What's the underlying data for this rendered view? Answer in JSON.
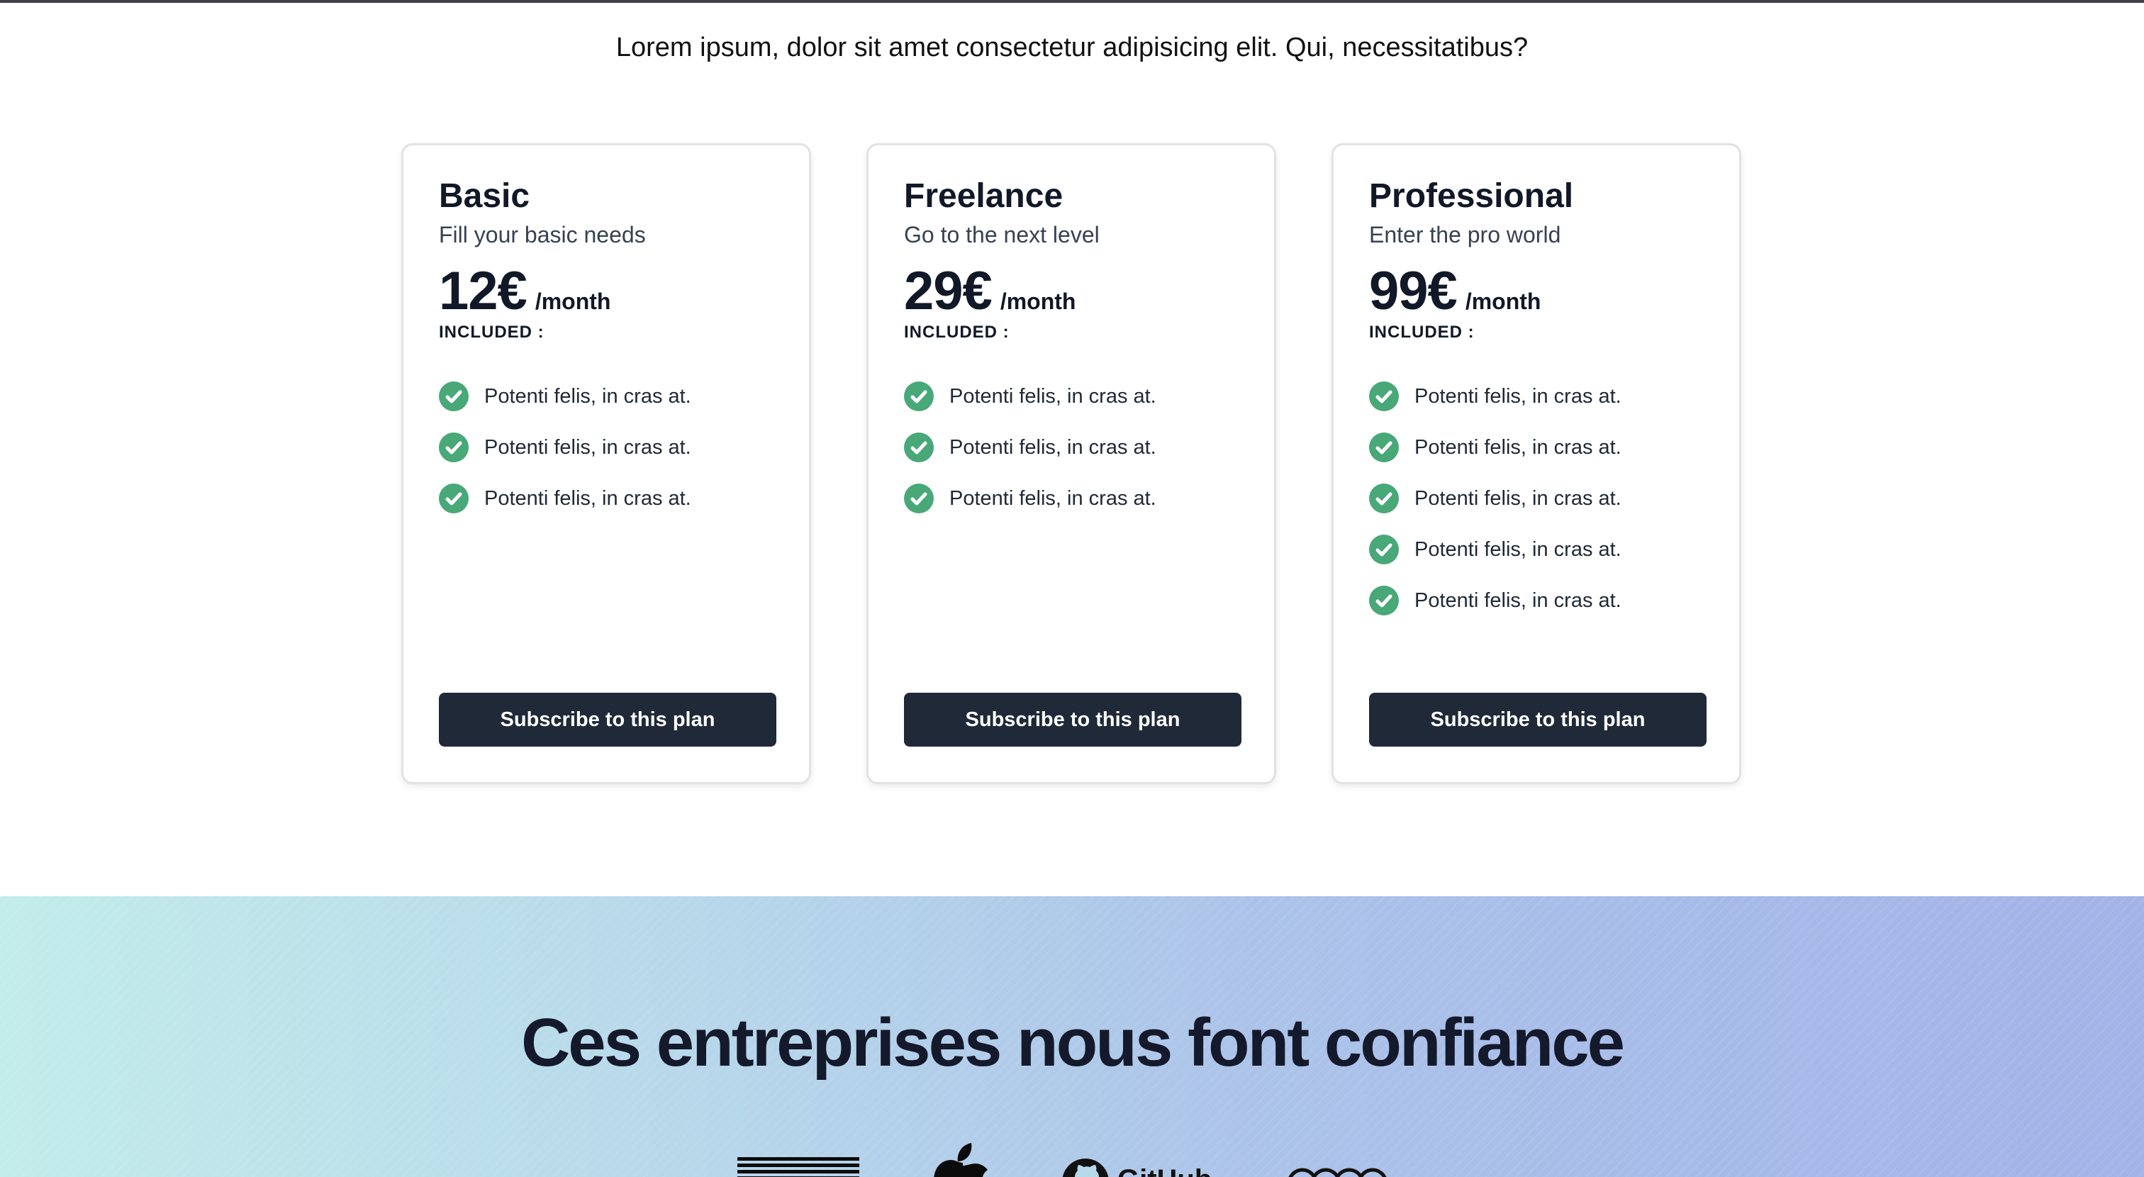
{
  "intro_text": "Lorem ipsum, dolor sit amet consectetur adipisicing elit. Qui, necessitatibus?",
  "plans": [
    {
      "name": "Basic",
      "subtitle": "Fill your basic needs",
      "price": "12€",
      "period": "/month",
      "included_label": "INCLUDED :",
      "features": [
        "Potenti felis, in cras at.",
        "Potenti felis, in cras at.",
        "Potenti felis, in cras at."
      ],
      "button_label": "Subscribe to this plan"
    },
    {
      "name": "Freelance",
      "subtitle": "Go to the next level",
      "price": "29€",
      "period": "/month",
      "included_label": "INCLUDED :",
      "features": [
        "Potenti felis, in cras at.",
        "Potenti felis, in cras at.",
        "Potenti felis, in cras at."
      ],
      "button_label": "Subscribe to this plan"
    },
    {
      "name": "Professional",
      "subtitle": "Enter the pro world",
      "price": "99€",
      "period": "/month",
      "included_label": "INCLUDED :",
      "features": [
        "Potenti felis, in cras at.",
        "Potenti felis, in cras at.",
        "Potenti felis, in cras at.",
        "Potenti felis, in cras at.",
        "Potenti felis, in cras at."
      ],
      "button_label": "Subscribe to this plan"
    }
  ],
  "trust": {
    "title": "Ces entreprises nous font confiance",
    "logos": [
      "ibm-logo",
      "apple-logo",
      "github-logo",
      "audi-logo"
    ],
    "github_label": "GitHub"
  },
  "colors": {
    "check_green": "#48a878",
    "button_dark": "#1f2937",
    "gradient_start": "#c2ecea",
    "gradient_end": "#a2b3e8"
  }
}
